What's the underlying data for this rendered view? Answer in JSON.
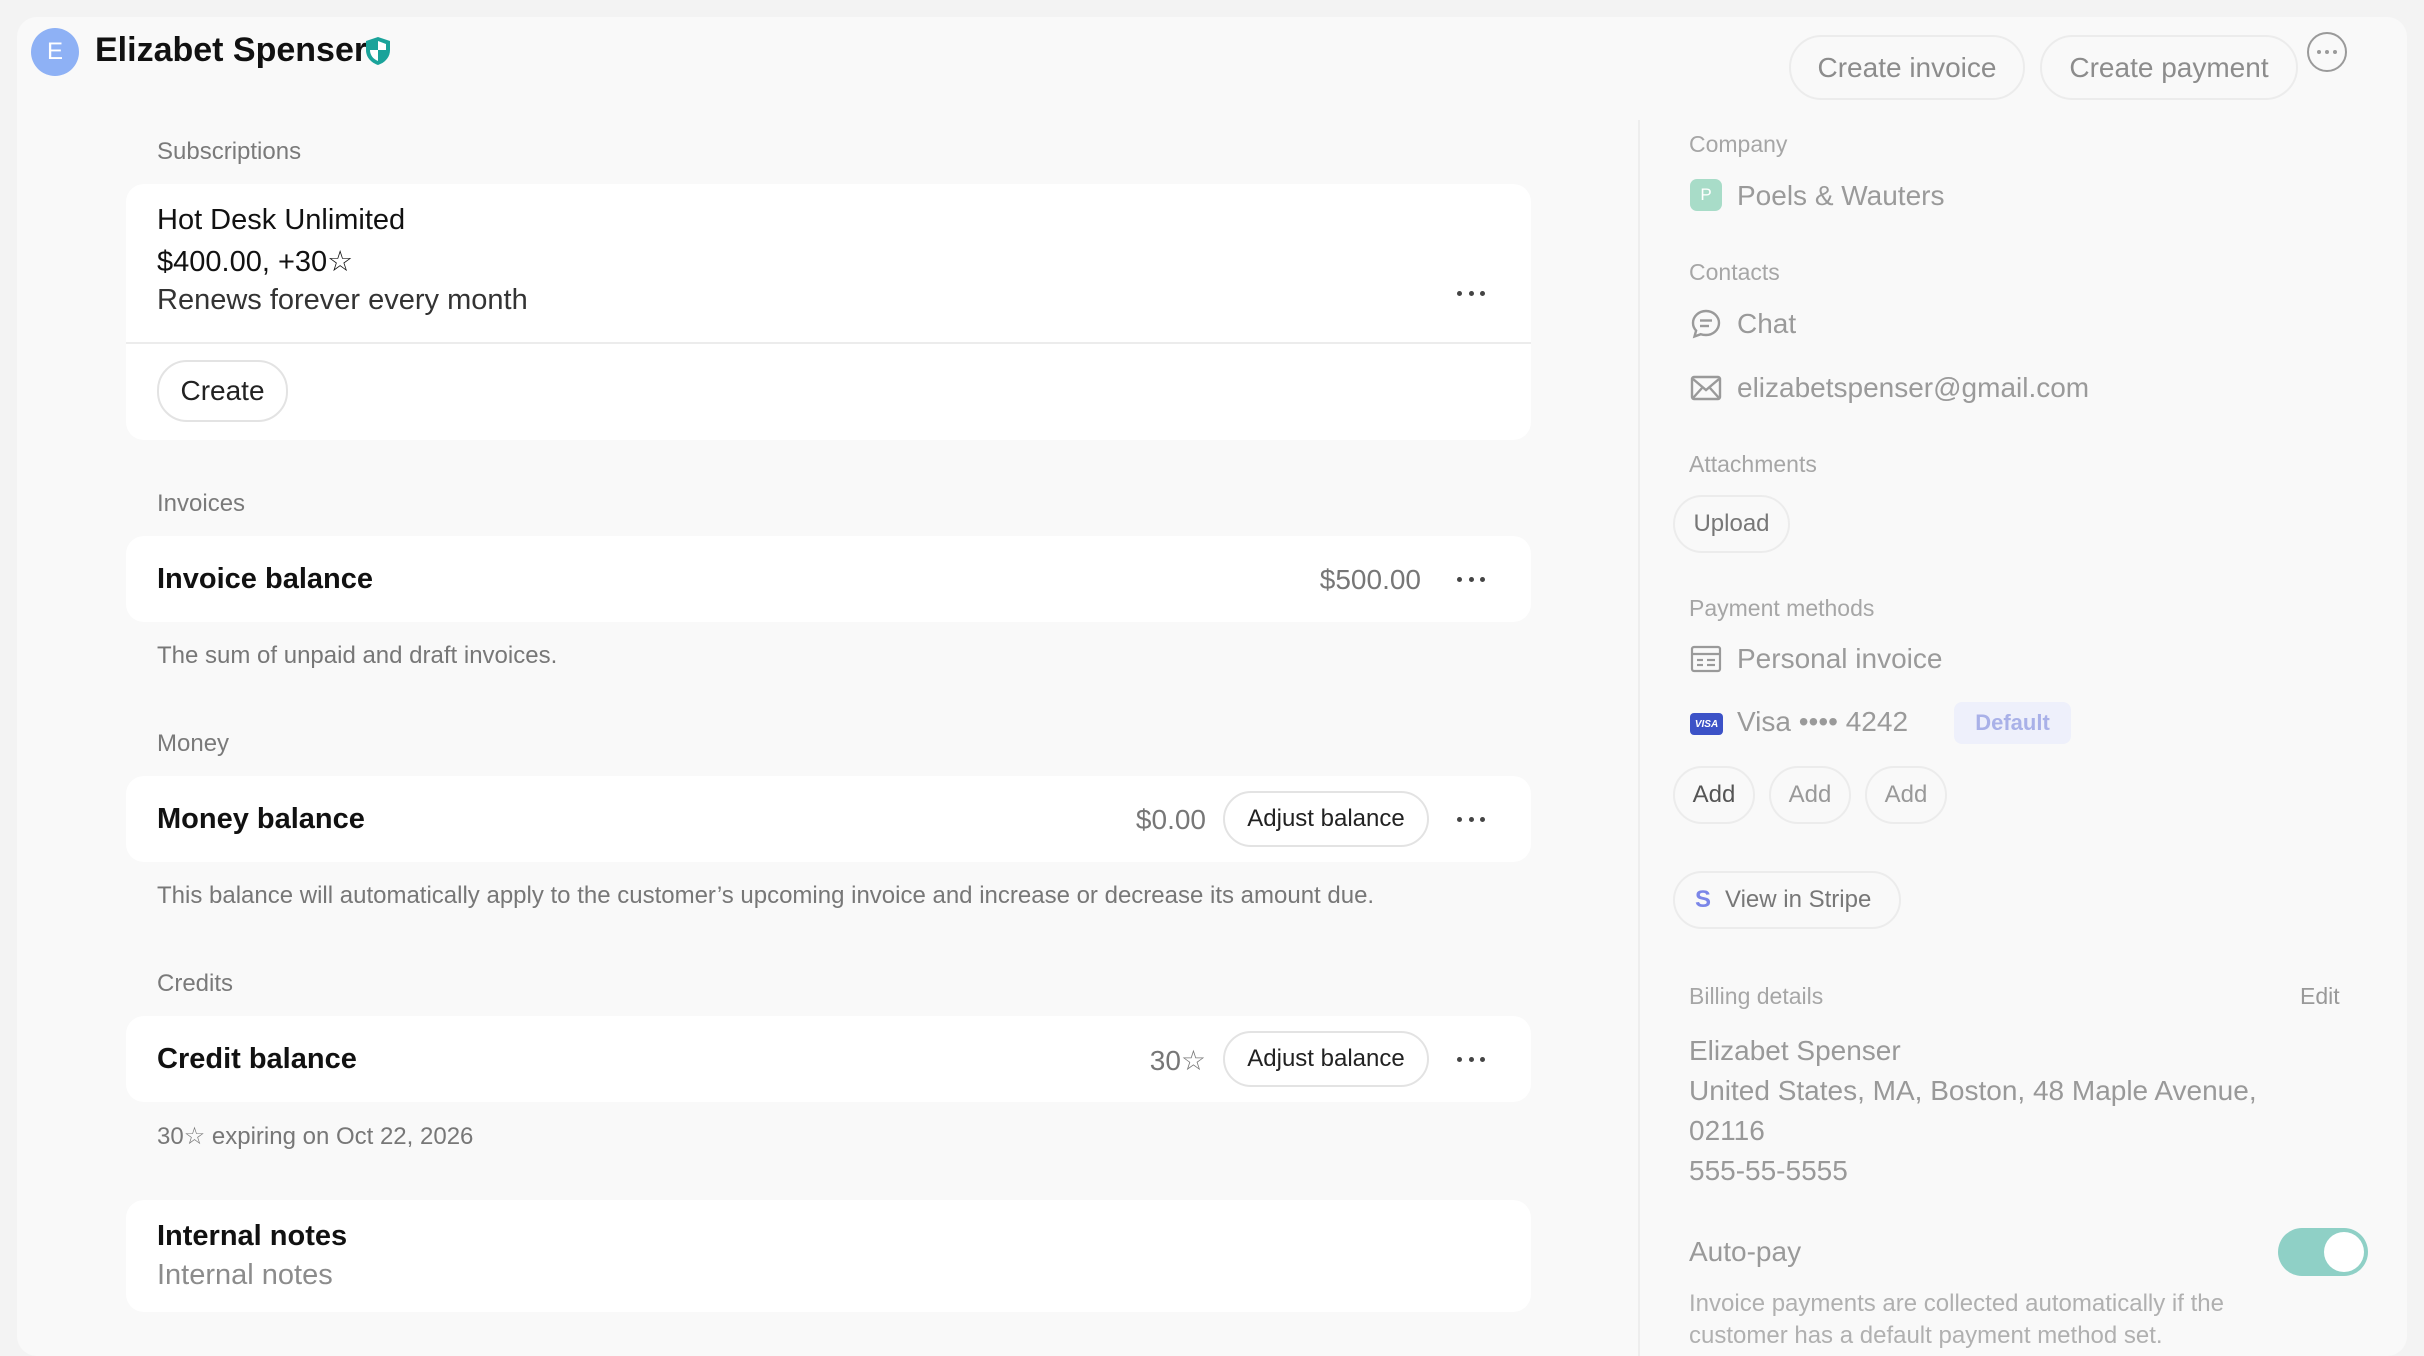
{
  "header": {
    "avatar_initial": "E",
    "customer_name": "Elizabet Spenser",
    "create_invoice_label": "Create invoice",
    "create_payment_label": "Create payment"
  },
  "subscriptions": {
    "section_label": "Subscriptions",
    "plan_name": "Hot Desk Unlimited",
    "price": "$400.00, +30☆",
    "renewal": "Renews forever every month",
    "create_label": "Create"
  },
  "invoices": {
    "section_label": "Invoices",
    "title": "Invoice balance",
    "amount": "$500.00",
    "help": "The sum of unpaid and draft invoices."
  },
  "money": {
    "section_label": "Money",
    "title": "Money balance",
    "amount": "$0.00",
    "adjust_label": "Adjust balance",
    "help": "This balance will automatically apply to the customer’s upcoming invoice and increase or decrease its amount due."
  },
  "credits": {
    "section_label": "Credits",
    "title": "Credit balance",
    "amount": "30☆",
    "adjust_label": "Adjust balance",
    "help": "30☆ expiring on Oct 22, 2026"
  },
  "notes": {
    "title": "Internal notes",
    "placeholder": "Internal notes"
  },
  "sidebar": {
    "company_label": "Company",
    "company_initial": "P",
    "company_name": "Poels & Wauters",
    "contacts_label": "Contacts",
    "chat_label": "Chat",
    "email": "elizabetspenser@gmail.com",
    "attachments_label": "Attachments",
    "upload_label": "Upload",
    "payment_methods_label": "Payment methods",
    "personal_invoice": "Personal invoice",
    "visa_label": "Visa •••• 4242",
    "visa_badge_text": "VISA",
    "default_badge": "Default",
    "add_buttons": [
      "Add",
      "Add",
      "Add"
    ],
    "stripe_letter": "S",
    "view_in_stripe": "View in Stripe",
    "billing_label": "Billing details",
    "edit_label": "Edit",
    "billing_name": "Elizabet Spenser",
    "billing_address_1": "United States, MA, Boston, 48 Maple Avenue,",
    "billing_address_2": "02116",
    "billing_phone": "555-55-5555",
    "autopay_label": "Auto-pay",
    "autopay_on": true,
    "autopay_help_1": "Invoice payments are collected automatically if the",
    "autopay_help_2": "customer has a default payment method set."
  },
  "colors": {
    "accent_teal": "#8fd0c6",
    "avatar_blue": "#8eb1f5",
    "stripe_purple": "#7b86e8"
  }
}
